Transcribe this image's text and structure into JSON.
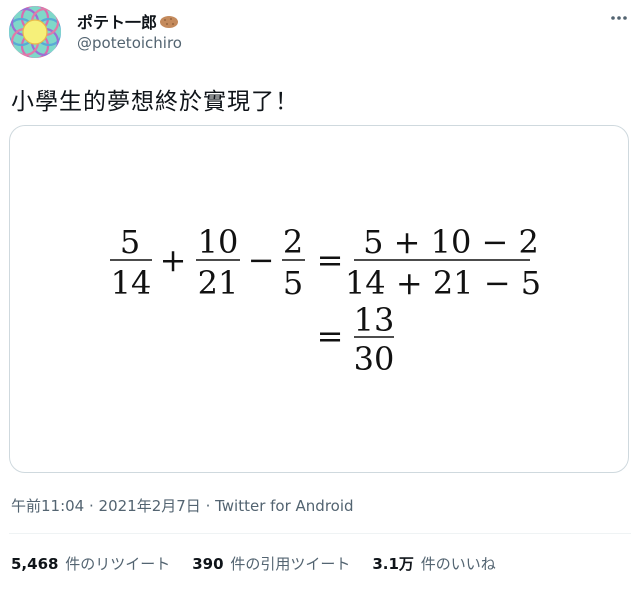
{
  "author": {
    "display_name": "ポテト一郎",
    "handle": "@potetoichiro",
    "emoji_icon": "potato-emoji-icon"
  },
  "tweet": {
    "text": "小學生的夢想終於實現了！",
    "timestamp": "午前11:04 · 2021年2月7日",
    "separator": " · ",
    "source": "Twitter for Android"
  },
  "media": {
    "equation": {
      "line1": {
        "frac1": [
          "5",
          "14"
        ],
        "op1": "+",
        "frac2": [
          "10",
          "21"
        ],
        "op2": "−",
        "frac3": [
          "2",
          "5"
        ],
        "eq": "=",
        "big_num": "5 + 10 − 2",
        "big_den": "14 + 21 − 5"
      },
      "line2": {
        "eq": "=",
        "result": [
          "13",
          "30"
        ]
      }
    }
  },
  "stats": [
    {
      "count": "5,468",
      "label": "件のリツイート"
    },
    {
      "count": "390",
      "label": "件の引用ツイート"
    },
    {
      "count": "3.1万",
      "label": "件のいいね"
    }
  ],
  "colors": {
    "text": "#0f1419",
    "secondary": "#536471",
    "border": "#cfd9de"
  }
}
